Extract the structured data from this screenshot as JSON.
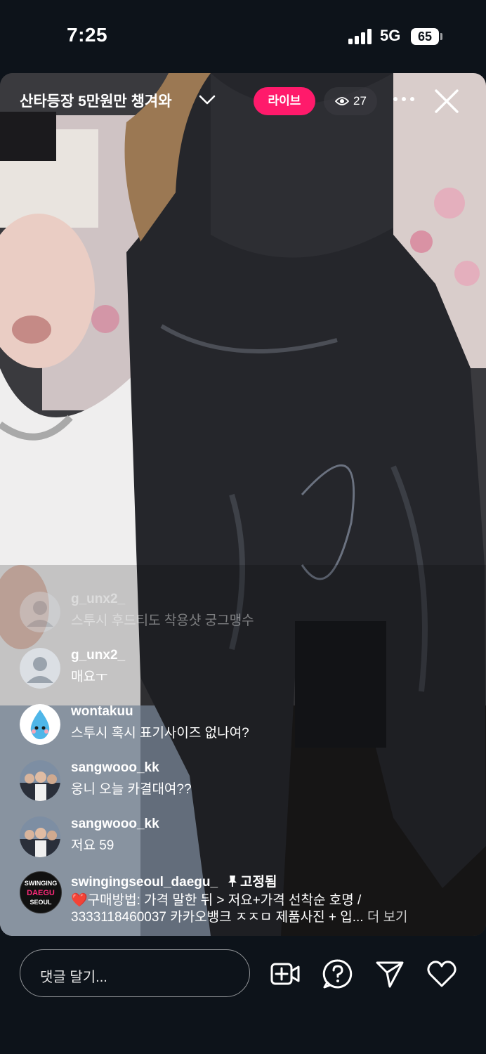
{
  "status_bar": {
    "time": "7:25",
    "network": "5G",
    "battery": "65"
  },
  "live": {
    "title": "산타등장 5만원만 챙겨와",
    "badge": "라이브",
    "viewer_count": "27"
  },
  "comments": [
    {
      "username": "g_unx2_",
      "text": "스투시 후드티도 착용샷 궁그맹수",
      "faded": true,
      "avatar": "default-avatar"
    },
    {
      "username": "g_unx2_",
      "text": "매요ㅜ",
      "avatar": "default-avatar"
    },
    {
      "username": "wontakuu",
      "text": "스투시 혹시 표기사이즈 없나여?",
      "avatar": "water-drop-character"
    },
    {
      "username": "sangwooo_kk",
      "text": "웅니 오늘 카결대여??",
      "avatar": "group-photo"
    },
    {
      "username": "sangwooo_kk",
      "text": "저요 59",
      "avatar": "group-photo"
    }
  ],
  "pinned_comment": {
    "username": "swingingseoul_daegu_",
    "pinned_label": "고정됨",
    "line1": "❤️구매방법: 가격 말한 뒤 > 저요+가격 선착순 호명 /",
    "line2": "3333118460037 카카오뱅크 ㅈㅈㅁ  제품사진 + 입...",
    "more": "더 보기",
    "avatar_text_top": "SWINGING",
    "avatar_text_mid": "DAEGU",
    "avatar_text_bot": "SEOUL"
  },
  "bottom_bar": {
    "comment_placeholder": "댓글 달기...",
    "icons": [
      "add-video-icon",
      "question-icon",
      "send-icon",
      "heart-icon"
    ]
  },
  "colors": {
    "live_badge": "#ff1a6b",
    "background": "#0d131a"
  }
}
